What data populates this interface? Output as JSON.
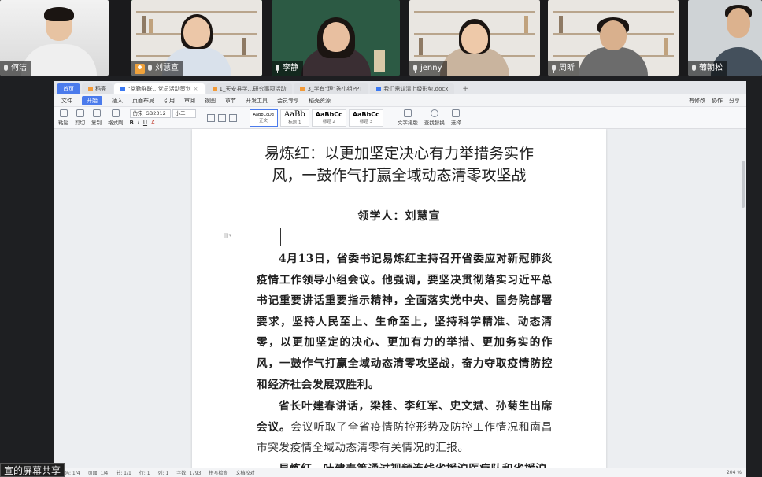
{
  "participants": [
    {
      "name": "何洁",
      "mic": "on"
    },
    {
      "name": "刘慧宣",
      "mic": "on",
      "avatar": true
    },
    {
      "name": "李静",
      "mic": "on"
    },
    {
      "name": "jenny",
      "mic": "on"
    },
    {
      "name": "周昕",
      "mic": "on"
    },
    {
      "name": "葡朝松",
      "mic": "on"
    }
  ],
  "tabs": [
    {
      "label": "首页"
    },
    {
      "label": "稻壳"
    },
    {
      "label": "“党勤群联…党员活动策划"
    },
    {
      "label": "1_天安县学…研究事项活动"
    },
    {
      "label": "3_学有“理”答小组PPT"
    },
    {
      "label": "我们需认清上级形势.docx"
    }
  ],
  "menu": {
    "items": [
      "文件",
      "开始",
      "插入",
      "页面布局",
      "引用",
      "审阅",
      "视图",
      "章节",
      "开发工具",
      "会员专享",
      "稻壳资源"
    ],
    "right": [
      "有修改",
      "协作",
      "分享"
    ]
  },
  "ribbon": {
    "tools": [
      "粘贴",
      "剪切",
      "复制",
      "格式刷"
    ],
    "font_name": "仿宋_GB2312",
    "font_size": "小二",
    "styles": [
      {
        "preview": "AaBbCcDd",
        "label": "正文"
      },
      {
        "preview": "AaBb",
        "label": "标题 1"
      },
      {
        "preview": "AaBbCc",
        "label": "标题 2"
      },
      {
        "preview": "AaBbCc",
        "label": "标题 3"
      }
    ],
    "right_tools": [
      "文字排版",
      "查找替换",
      "选择"
    ]
  },
  "document": {
    "title_line1": "易炼红：以更加坚定决心有力举措务实作",
    "title_line2": "风，一鼓作气打赢全域动态清零攻坚战",
    "leader": "领学人：刘慧宣",
    "para1": "4月13日，省委书记易炼红主持召开省委应对新冠肺炎疫情工作领导小组会议。他强调，要坚决贯彻落实习近平总书记重要讲话重要指示精神，全面落实党中央、国务院部署要求，坚持人民至上、生命至上，坚持科学精准、动态清零，以更加坚定的决心、更加有力的举措、更加务实的作风，一鼓作气打赢全域动态清零攻坚战，奋力夺取疫情防控和经济社会发展双胜利。",
    "para2_bold": "省长叶建春讲话，梁桂、李红军、史文斌、孙菊生出席会议。",
    "para2_light": "会议听取了全省疫情防控形势及防控工作情况和南昌市突发疫情全域动态清零有关情况的汇报。",
    "para3": "易炼红、叶建春等通过视频连线省援沪医疗队和省援沪"
  },
  "statusbar": {
    "left": [
      "页码: 1/4",
      "页面: 1/4",
      "节: 1/1",
      "行: 1",
      "列: 1",
      "字数: 1793",
      "拼写检查",
      "文档校对"
    ],
    "right": [
      "204 %"
    ]
  },
  "share_badge": "宣的屏幕共享"
}
